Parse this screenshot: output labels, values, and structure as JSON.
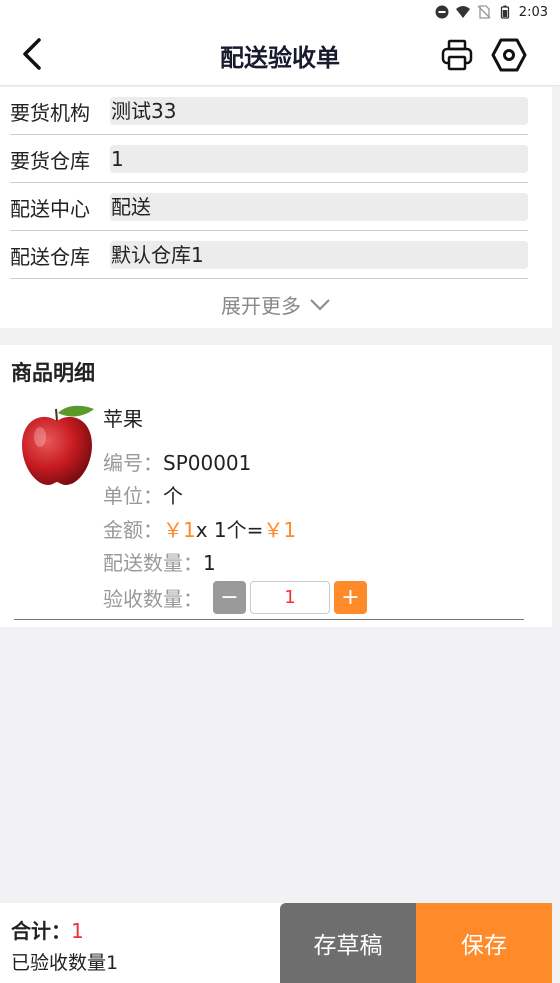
{
  "status_bar": {
    "time": "2:03",
    "icons": [
      "do-not-disturb-icon",
      "wifi-icon",
      "no-sim-icon",
      "battery-icon"
    ]
  },
  "header": {
    "title": "配送验收单",
    "back_icon": "chevron-left-icon",
    "print_icon": "printer-icon",
    "settings_icon": "hexagon-settings-icon"
  },
  "info": {
    "rows": [
      {
        "label": "要货机构",
        "value": "测试33"
      },
      {
        "label": "要货仓库",
        "value": "1"
      },
      {
        "label": "配送中心",
        "value": "配送"
      },
      {
        "label": "配送仓库",
        "value": "默认仓库1"
      }
    ],
    "expand_label": "展开更多"
  },
  "goods": {
    "section_title": "商品明细",
    "item": {
      "name": "苹果",
      "code_label": "编号：",
      "code": "SP00001",
      "unit_label": "单位：",
      "unit": "个",
      "amount_label": "金额：",
      "price": "￥1",
      "qty_text": "x 1个=",
      "amount": "￥1",
      "delivered_label": "配送数量：",
      "delivered_qty": "1",
      "accepted_label": "验收数量：",
      "accepted_qty": "1",
      "minus_label": "−",
      "plus_label": "+"
    }
  },
  "footer": {
    "total_label": "合计：",
    "total_value": "1",
    "accepted_summary": "已验收数量1",
    "draft_label": "存草稿",
    "save_label": "保存"
  },
  "colors": {
    "accent": "#ff8a2a",
    "draft_bg": "#6e6e6e",
    "highlight_red": "#e33333"
  }
}
